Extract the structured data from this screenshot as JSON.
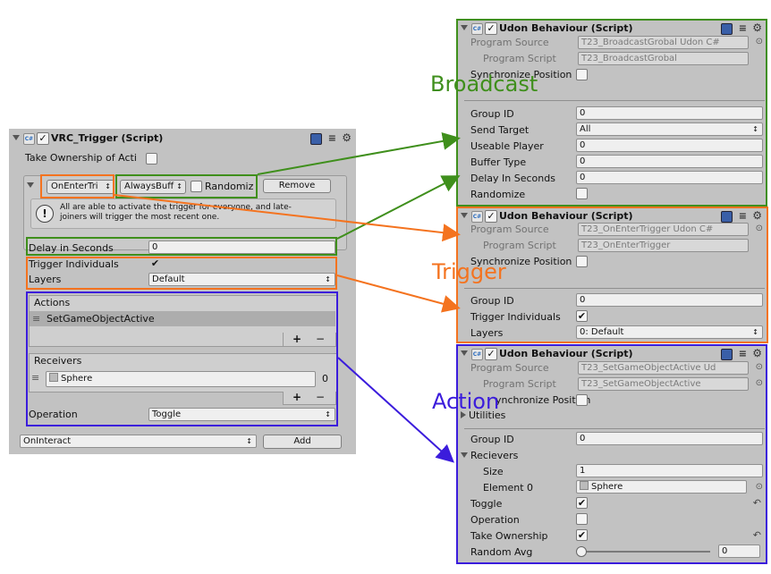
{
  "colors": {
    "broadcast": "#3f8f1c",
    "trigger": "#f4731f",
    "action": "#3b1cdc",
    "panel": "#c2c2c2"
  },
  "vrc_trigger": {
    "title": "VRC_Trigger (Script)",
    "take_ownership_label": "Take Ownership of Acti",
    "trigger_type": "OnEnterTri",
    "broadcast_type": "AlwaysBuff",
    "randomize_label": "Randomiz",
    "remove_label": "Remove",
    "info_text": "All are able to activate the trigger for everyone, and late-joiners will trigger the most recent one.",
    "delay_label": "Delay in Seconds",
    "delay_value": "0",
    "trigger_individuals_label": "Trigger Individuals",
    "trigger_individuals_checked": true,
    "layers_label": "Layers",
    "layers_value": "Default",
    "actions_header": "Actions",
    "action_item": "SetGameObjectActive",
    "receivers_header": "Receivers",
    "receiver_item": "Sphere",
    "receiver_index": "0",
    "plus": "+",
    "minus": "−",
    "operation_label": "Operation",
    "operation_value": "Toggle",
    "add_event": "OnInteract",
    "add_label": "Add"
  },
  "udon_broadcast": {
    "title": "Udon Behaviour (Script)",
    "program_source_label": "Program Source",
    "program_source_value": "T23_BroadcastGrobal Udon C#",
    "program_script_label": "Program Script",
    "program_script_value": "T23_BroadcastGrobal",
    "sync_label": "Synchronize Position",
    "group_id_label": "Group ID",
    "group_id_value": "0",
    "send_target_label": "Send Target",
    "send_target_value": "All",
    "useable_player_label": "Useable Player",
    "useable_player_value": "0",
    "buffer_type_label": "Buffer Type",
    "buffer_type_value": "0",
    "delay_label": "Delay In Seconds",
    "delay_value": "0",
    "randomize_label": "Randomize"
  },
  "udon_trigger": {
    "title": "Udon Behaviour (Script)",
    "program_source_label": "Program Source",
    "program_source_value": "T23_OnEnterTrigger Udon C#",
    "program_script_label": "Program Script",
    "program_script_value": "T23_OnEnterTrigger",
    "sync_label": "Synchronize Position",
    "group_id_label": "Group ID",
    "group_id_value": "0",
    "trigger_individuals_label": "Trigger Individuals",
    "layers_label": "Layers",
    "layers_value": "0: Default"
  },
  "udon_action": {
    "title": "Udon Behaviour (Script)",
    "program_source_label": "Program Source",
    "program_source_value": "T23_SetGameObjectActive Ud",
    "program_script_label": "Program Script",
    "program_script_value": "T23_SetGameObjectActive",
    "sync_label": "ynchronize Position",
    "utilities_label": "Utilities",
    "group_id_label": "Group ID",
    "group_id_value": "0",
    "receivers_label": "Recievers",
    "size_label": "Size",
    "size_value": "1",
    "element_label": "Element 0",
    "element_value": "Sphere",
    "toggle_label": "Toggle",
    "operation_label": "Operation",
    "take_ownership_label": "Take Ownership",
    "random_avg_label": "Random Avg",
    "random_avg_value": "0"
  },
  "annotations": {
    "broadcast": "Broadcast",
    "trigger": "Trigger",
    "action": "Action"
  }
}
